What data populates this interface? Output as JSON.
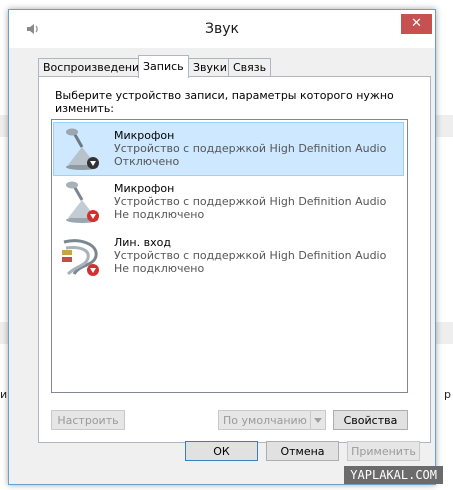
{
  "background": {
    "left_text": "икр",
    "right_text": "р"
  },
  "window": {
    "title": "Звук",
    "close_glyph": "✕"
  },
  "tabs": [
    {
      "label": "Воспроизведение",
      "active": false
    },
    {
      "label": "Запись",
      "active": true
    },
    {
      "label": "Звуки",
      "active": false
    },
    {
      "label": "Связь",
      "active": false
    }
  ],
  "instruction": "Выберите устройство записи, параметры которого нужно изменить:",
  "devices": [
    {
      "name": "Микрофон",
      "description": "Устройство с поддержкой High Definition Audio",
      "status": "Отключено",
      "selected": true,
      "icon": "microphone-icon",
      "badge": "down-arrow-badge"
    },
    {
      "name": "Микрофон",
      "description": "Устройство с поддержкой High Definition Audio",
      "status": "Не подключено",
      "selected": false,
      "icon": "microphone-icon",
      "badge": "red-down-arrow-badge"
    },
    {
      "name": "Лин. вход",
      "description": "Устройство с поддержкой High Definition Audio",
      "status": "Не подключено",
      "selected": false,
      "icon": "line-in-cable-icon",
      "badge": "red-down-arrow-badge"
    }
  ],
  "buttons": {
    "configure": "Настроить",
    "default": "По умолчанию",
    "properties": "Свойства",
    "ok": "ОК",
    "cancel": "Отмена",
    "apply": "Применить"
  },
  "watermark": "YAPLAKAL.COM"
}
